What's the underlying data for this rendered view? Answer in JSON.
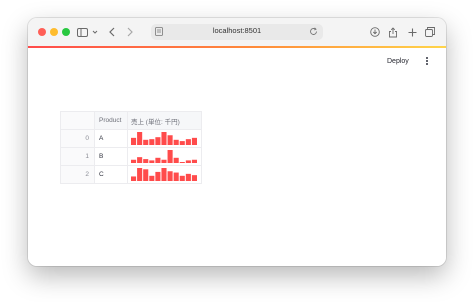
{
  "browser": {
    "url": "localhost:8501"
  },
  "app": {
    "deploy_label": "Deploy"
  },
  "table": {
    "columns": [
      "",
      "Product",
      "売上 (単位: 千円)"
    ],
    "rows": [
      {
        "index": "0",
        "product": "A",
        "sales": [
          55,
          100,
          40,
          45,
          60,
          100,
          75,
          40,
          30,
          45,
          55
        ]
      },
      {
        "index": "1",
        "product": "B",
        "sales": [
          25,
          45,
          30,
          20,
          40,
          25,
          100,
          40,
          0,
          20,
          25
        ]
      },
      {
        "index": "2",
        "product": "C",
        "sales": [
          35,
          100,
          90,
          40,
          70,
          100,
          75,
          65,
          40,
          55,
          45
        ]
      }
    ]
  },
  "colors": {
    "bar": "#ff4b4b",
    "accent_start": "#ff4b4b",
    "accent_end": "#ffd54a"
  }
}
